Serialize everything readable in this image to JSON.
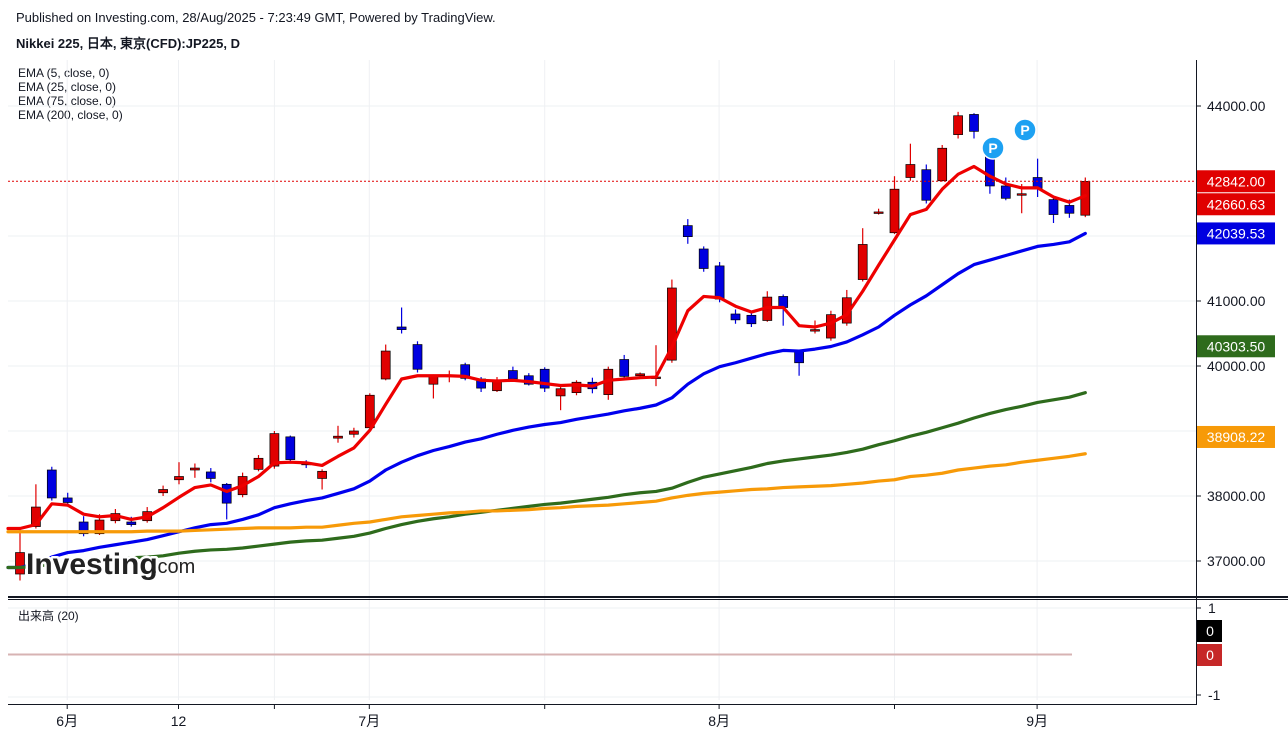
{
  "header": {
    "published": "Published on Investing.com, 28/Aug/2025 - 7:23:49 GMT, Powered by TradingView.",
    "title": "Nikkei 225, 日本, 東京(CFD):JP225, D"
  },
  "legend": {
    "items": [
      "EMA (5, close, 0)",
      "EMA (25, close, 0)",
      "EMA (75, close, 0)",
      "EMA (200, close, 0)"
    ]
  },
  "logo": {
    "main": "Investing",
    "suffix": ".com"
  },
  "price_tags": [
    {
      "label": "42842.00",
      "value": 42842.0,
      "color": "#e00000"
    },
    {
      "label": "42660.63",
      "value": 42660.63,
      "color": "#e00000"
    },
    {
      "label": "42039.53",
      "value": 42039.53,
      "color": "#0000e0"
    },
    {
      "label": "40303.50",
      "value": 40303.5,
      "color": "#2e6b1c"
    },
    {
      "label": "38908.22",
      "value": 38908.22,
      "color": "#f79a08"
    }
  ],
  "volume_pane": {
    "title": "出来高 (20)",
    "ticks": [
      "1",
      "-1"
    ],
    "tags": [
      {
        "label": "0",
        "color": "#000000"
      },
      {
        "label": "0",
        "color": "#c62828"
      }
    ]
  },
  "chart_data": {
    "type": "candlestick",
    "ylim": [
      36500,
      44500
    ],
    "yticks": [
      {
        "label": "37000.00",
        "value": 37000
      },
      {
        "label": "38000.00",
        "value": 38000
      },
      {
        "label": "39000.00",
        "value": 39000
      },
      {
        "label": "40000.00",
        "value": 40000
      },
      {
        "label": "41000.00",
        "value": 41000
      },
      {
        "label": "42000.00",
        "value": 42000
      },
      {
        "label": "44000.00",
        "value": 44000
      }
    ],
    "xticks": [
      {
        "label": "6月",
        "index": 3
      },
      {
        "label": "12",
        "index": 10
      },
      {
        "label": "7月",
        "index": 22
      },
      {
        "label": "8月",
        "index": 44
      },
      {
        "label": "9月",
        "index": 64
      }
    ],
    "up_color": "#e00000",
    "down_color": "#0000e0",
    "current_price": 42842.0,
    "candles": [
      [
        36800,
        37130,
        36700,
        37500
      ],
      [
        37530,
        37830,
        37500,
        38180
      ],
      [
        38400,
        37970,
        37930,
        38450
      ],
      [
        37970,
        37900,
        37840,
        38050
      ],
      [
        37600,
        37420,
        37380,
        37690
      ],
      [
        37420,
        37630,
        37400,
        37720
      ],
      [
        37620,
        37730,
        37580,
        37800
      ],
      [
        37600,
        37560,
        37530,
        37680
      ],
      [
        37620,
        37760,
        37590,
        37830
      ],
      [
        38050,
        38100,
        38000,
        38160
      ],
      [
        38250,
        38300,
        38180,
        38520
      ],
      [
        38400,
        38430,
        38280,
        38500
      ],
      [
        38370,
        38270,
        38210,
        38430
      ],
      [
        38180,
        37890,
        37640,
        38200
      ],
      [
        38020,
        38300,
        37980,
        38360
      ],
      [
        38410,
        38580,
        38380,
        38630
      ],
      [
        38460,
        38960,
        38420,
        39000
      ],
      [
        38910,
        38560,
        38500,
        38930
      ],
      [
        38510,
        38480,
        38430,
        38550
      ],
      [
        38270,
        38380,
        38100,
        38410
      ],
      [
        38890,
        38920,
        38820,
        39080
      ],
      [
        38950,
        39000,
        38900,
        39050
      ],
      [
        39050,
        39550,
        39040,
        39580
      ],
      [
        39800,
        40230,
        39780,
        40330
      ],
      [
        40600,
        40560,
        40500,
        40900
      ],
      [
        40330,
        39950,
        39900,
        40380
      ],
      [
        39720,
        39850,
        39500,
        39870
      ],
      [
        39840,
        39860,
        39750,
        39930
      ],
      [
        40020,
        39810,
        39780,
        40050
      ],
      [
        39800,
        39660,
        39600,
        39830
      ],
      [
        39620,
        39770,
        39600,
        39830
      ],
      [
        39930,
        39800,
        39760,
        39990
      ],
      [
        39850,
        39720,
        39700,
        39890
      ],
      [
        39950,
        39660,
        39600,
        39980
      ],
      [
        39540,
        39650,
        39320,
        39700
      ],
      [
        39590,
        39750,
        39550,
        39780
      ],
      [
        39750,
        39650,
        39580,
        39820
      ],
      [
        39560,
        39950,
        39480,
        39990
      ],
      [
        40100,
        39840,
        39820,
        40170
      ],
      [
        39850,
        39880,
        39800,
        39900
      ],
      [
        39830,
        39830,
        39690,
        40320
      ],
      [
        40090,
        41200,
        40050,
        41330
      ],
      [
        42160,
        41990,
        41880,
        42260
      ],
      [
        41800,
        41500,
        41450,
        41840
      ],
      [
        41540,
        41030,
        40980,
        41600
      ],
      [
        40800,
        40710,
        40650,
        40870
      ],
      [
        40780,
        40650,
        40600,
        40820
      ],
      [
        40700,
        41060,
        40680,
        41150
      ],
      [
        41070,
        40900,
        40620,
        41100
      ],
      [
        40220,
        40050,
        39850,
        40240
      ],
      [
        40540,
        40560,
        40500,
        40700
      ],
      [
        40430,
        40790,
        40390,
        40850
      ],
      [
        40660,
        41050,
        40620,
        41170
      ],
      [
        41330,
        41870,
        41300,
        42120
      ],
      [
        42350,
        42370,
        42330,
        42420
      ],
      [
        42050,
        42720,
        42030,
        42920
      ],
      [
        42900,
        43100,
        42850,
        43420
      ],
      [
        43020,
        42550,
        42500,
        43100
      ],
      [
        42850,
        43350,
        42840,
        43400
      ],
      [
        43560,
        43850,
        43500,
        43910
      ],
      [
        43870,
        43610,
        43500,
        43890
      ],
      [
        43360,
        42770,
        42650,
        43400
      ],
      [
        42770,
        42580,
        42550,
        42900
      ],
      [
        42640,
        42650,
        42350,
        42800
      ],
      [
        42900,
        42730,
        42600,
        43190
      ],
      [
        42560,
        42330,
        42200,
        42620
      ],
      [
        42470,
        42350,
        42280,
        42560
      ],
      [
        42320,
        42840,
        42290,
        42900
      ]
    ],
    "series": [
      {
        "name": "EMA (5, close, 0)",
        "color": "#ee0000",
        "values": [
          37500,
          37560,
          37880,
          37860,
          37720,
          37680,
          37700,
          37640,
          37680,
          37820,
          37980,
          38130,
          38170,
          38070,
          38160,
          38300,
          38510,
          38520,
          38510,
          38470,
          38610,
          38740,
          39010,
          39410,
          39800,
          39850,
          39850,
          39850,
          39840,
          39780,
          39770,
          39780,
          39760,
          39730,
          39700,
          39710,
          39690,
          39780,
          39800,
          39820,
          39830,
          40290,
          40850,
          41070,
          41050,
          40920,
          40830,
          40900,
          40900,
          40620,
          40600,
          40660,
          40790,
          41150,
          41550,
          41940,
          42330,
          42410,
          42720,
          42950,
          43070,
          42920,
          42800,
          42740,
          42740,
          42600,
          42520,
          42620
        ]
      },
      {
        "name": "EMA (25, close, 0)",
        "color": "#0000ee",
        "values": [
          36900,
          36960,
          37060,
          37130,
          37160,
          37210,
          37250,
          37290,
          37330,
          37390,
          37450,
          37510,
          37560,
          37580,
          37640,
          37710,
          37820,
          37880,
          37930,
          37970,
          38040,
          38110,
          38230,
          38400,
          38520,
          38620,
          38700,
          38760,
          38830,
          38880,
          38950,
          39010,
          39060,
          39100,
          39130,
          39180,
          39220,
          39260,
          39310,
          39350,
          39400,
          39510,
          39720,
          39880,
          39990,
          40050,
          40120,
          40190,
          40240,
          40230,
          40260,
          40300,
          40370,
          40480,
          40600,
          40780,
          40940,
          41080,
          41250,
          41420,
          41560,
          41630,
          41700,
          41770,
          41840,
          41870,
          41910,
          42040
        ]
      },
      {
        "name": "EMA (75, close, 0)",
        "color": "#2e6b1c",
        "values": [
          36900,
          36920,
          36950,
          36970,
          36990,
          37010,
          37030,
          37050,
          37060,
          37080,
          37120,
          37150,
          37170,
          37180,
          37200,
          37230,
          37260,
          37290,
          37310,
          37320,
          37350,
          37380,
          37430,
          37500,
          37560,
          37610,
          37650,
          37680,
          37720,
          37750,
          37780,
          37810,
          37840,
          37870,
          37890,
          37920,
          37950,
          37980,
          38020,
          38050,
          38070,
          38120,
          38210,
          38290,
          38340,
          38390,
          38440,
          38500,
          38540,
          38570,
          38600,
          38630,
          38670,
          38720,
          38790,
          38850,
          38920,
          38980,
          39050,
          39120,
          39200,
          39270,
          39330,
          39380,
          39440,
          39480,
          39520,
          39590
        ]
      },
      {
        "name": "EMA (200, close, 0)",
        "color": "#f79a08",
        "values": [
          37450,
          37450,
          37450,
          37450,
          37450,
          37450,
          37450,
          37450,
          37460,
          37460,
          37460,
          37470,
          37480,
          37490,
          37500,
          37510,
          37510,
          37510,
          37520,
          37520,
          37550,
          37580,
          37600,
          37640,
          37680,
          37700,
          37720,
          37740,
          37750,
          37770,
          37770,
          37780,
          37790,
          37810,
          37820,
          37840,
          37850,
          37860,
          37880,
          37900,
          37920,
          37970,
          38010,
          38040,
          38060,
          38080,
          38100,
          38110,
          38130,
          38140,
          38150,
          38160,
          38180,
          38200,
          38230,
          38250,
          38300,
          38320,
          38350,
          38400,
          38430,
          38460,
          38480,
          38520,
          38550,
          38580,
          38610,
          38650
        ]
      }
    ]
  }
}
